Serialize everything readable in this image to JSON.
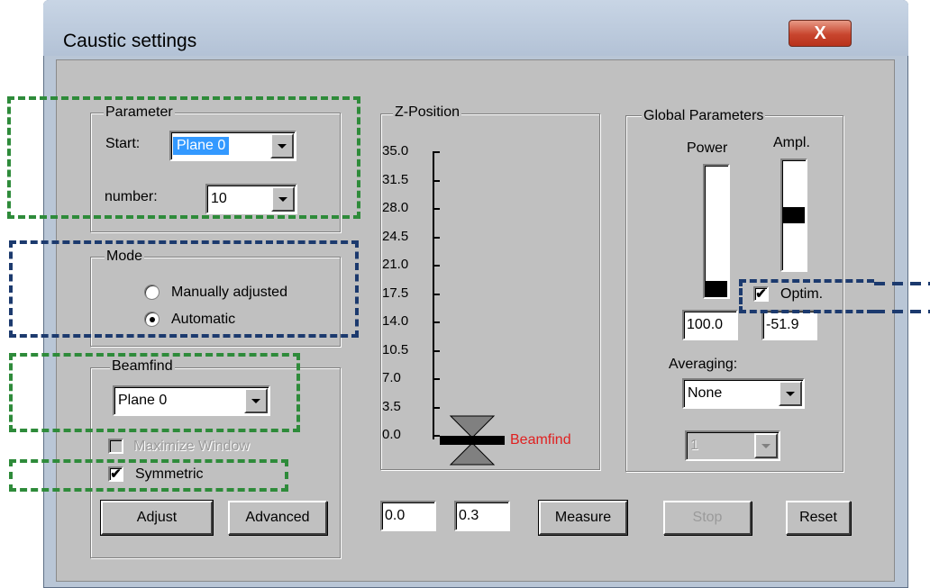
{
  "window": {
    "title": "Caustic settings",
    "close_label": "X"
  },
  "parameter": {
    "legend": "Parameter",
    "start_label": "Start:",
    "start_value": "Plane 0",
    "number_label": "number:",
    "number_value": "10"
  },
  "mode": {
    "legend": "Mode",
    "options": [
      "Manually adjusted",
      "Automatic"
    ],
    "selected": "Automatic"
  },
  "beamfind": {
    "legend": "Beamfind",
    "value": "Plane 0",
    "maximize_label": "Maximize Window",
    "symmetric_label": "Symmetric",
    "symmetric_checked": true,
    "maximize_checked": false,
    "adjust_label": "Adjust",
    "advanced_label": "Advanced"
  },
  "zposition": {
    "legend": "Z-Position",
    "ticks": [
      "35.0",
      "31.5",
      "28.0",
      "24.5",
      "21.0",
      "17.5",
      "14.0",
      "10.5",
      "7.0",
      "3.5",
      "0.0"
    ],
    "marker_label": "Beamfind",
    "marker_color": "#e02020"
  },
  "global": {
    "legend": "Global Parameters",
    "power_label": "Power",
    "ampl_label": "Ampl.",
    "power_level": 0.0,
    "ampl_level": 0.5,
    "optim_label": "Optim.",
    "optim_checked": true,
    "power_value": "100.0",
    "ampl_value": "-51.9",
    "averaging_label": "Averaging:",
    "averaging_value": "None",
    "disabled_combo_value": "1"
  },
  "bottom": {
    "field1": "0.0",
    "field2": "0.3",
    "measure_label": "Measure",
    "stop_label": "Stop",
    "reset_label": "Reset"
  },
  "colors": {
    "annotation_green": "#2e8b3a",
    "annotation_blue": "#1c3a6e",
    "selection": "#3399ff"
  }
}
